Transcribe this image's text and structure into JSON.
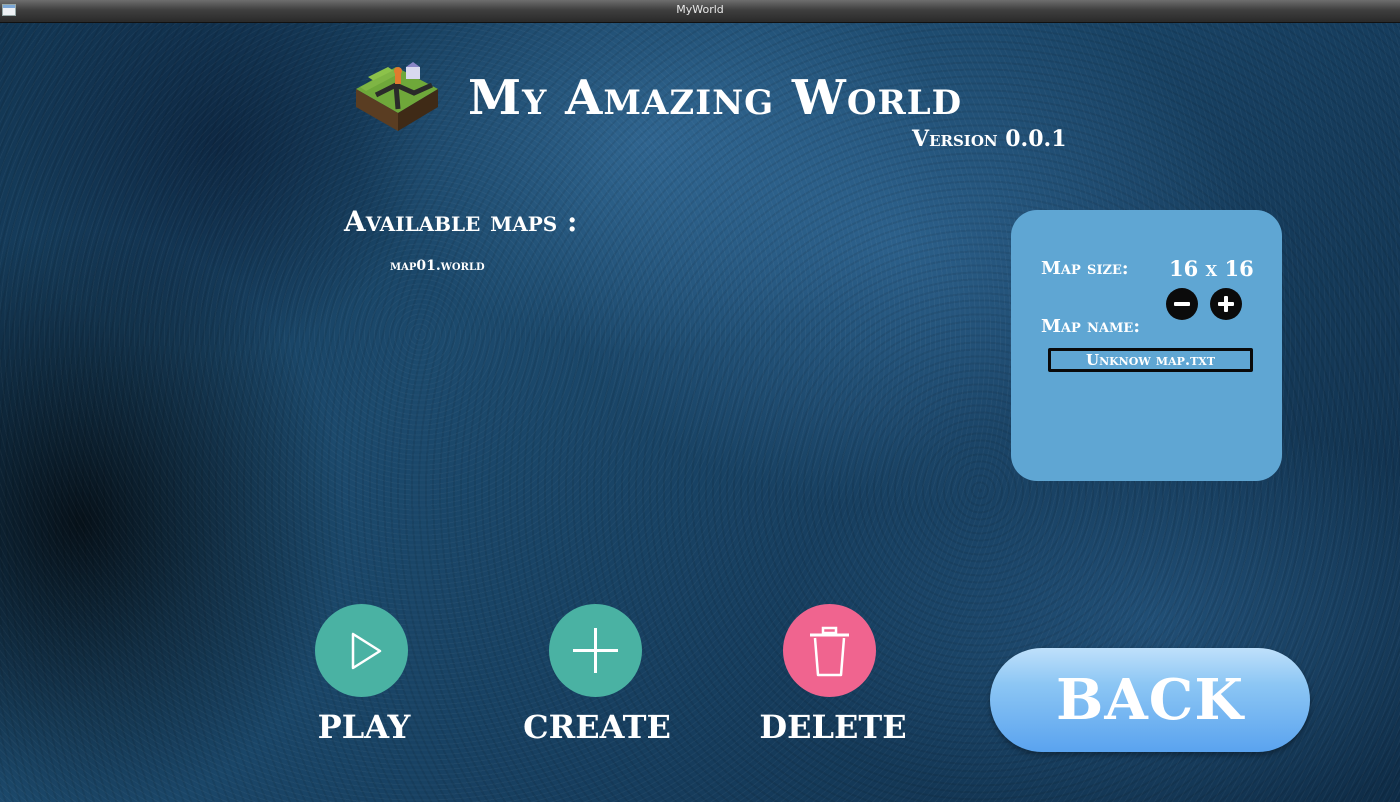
{
  "window": {
    "title": "MyWorld"
  },
  "header": {
    "title": "My Amazing World",
    "version": "Version 0.0.1"
  },
  "maps": {
    "heading": "Available maps :",
    "items": [
      "map01.world"
    ]
  },
  "settings_panel": {
    "size_label": "Map size:",
    "size_value": "16 x 16",
    "name_label": "Map name:",
    "name_value": "Unknow map.txt",
    "bg_color": "#5fa6d3"
  },
  "actions": {
    "play_label": "PLAY",
    "create_label": "CREATE",
    "delete_label": "DELETE",
    "back_label": "BACK",
    "play_color": "#4ab2a3",
    "create_color": "#4ab2a3",
    "delete_color": "#f0648f"
  },
  "icons": {
    "logo": "isometric-terrain-tile-icon",
    "play": "play-triangle-icon",
    "create": "plus-icon",
    "delete": "trash-can-icon",
    "decrease": "minus-circle-icon",
    "increase": "plus-circle-icon"
  }
}
